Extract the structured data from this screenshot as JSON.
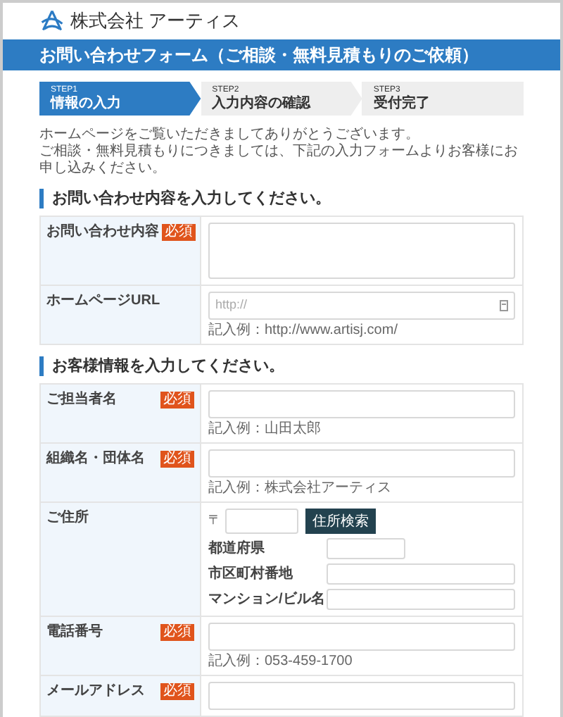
{
  "logo": {
    "company": "株式会社 アーティス"
  },
  "banner": {
    "title": "お問い合わせフォーム（ご相談・無料見積もりのご依頼）"
  },
  "steps": [
    {
      "step": "STEP1",
      "label": "情報の入力",
      "selected": true
    },
    {
      "step": "STEP2",
      "label": "入力内容の確認",
      "selected": false
    },
    {
      "step": "STEP3",
      "label": "受付完了",
      "selected": false
    }
  ],
  "intro": [
    "ホームページをご覧いただきましてありがとうございます。",
    "ご相談・無料見積もりにつきましては、下記の入力フォームよりお客様にお申し込みください。"
  ],
  "sections": [
    {
      "heading": "お問い合わせ内容を入力してください。",
      "rows": [
        {
          "kind": "textarea",
          "label": "お問い合わせ内容",
          "required": true,
          "badge": "必須"
        },
        {
          "kind": "input",
          "label": "ホームページURL",
          "required": false,
          "placeholder": "http://",
          "icon": true,
          "hint": "記入例：http://www.artisj.com/"
        }
      ]
    },
    {
      "heading": "お客様情報を入力してください。",
      "rows": [
        {
          "kind": "input",
          "label": "ご担当者名",
          "required": true,
          "badge": "必須",
          "hint": "記入例：山田太郎"
        },
        {
          "kind": "input",
          "label": "組織名・団体名",
          "required": true,
          "badge": "必須",
          "hint": "記入例：株式会社アーティス"
        },
        {
          "kind": "address",
          "label": "ご住所",
          "required": false,
          "postal_mark": "〒",
          "search_button": "住所検索",
          "fields": [
            {
              "label": "都道府県",
              "short": true
            },
            {
              "label": "市区町村番地",
              "short": false
            },
            {
              "label": "マンション/ビル名",
              "short": false
            }
          ]
        },
        {
          "kind": "input",
          "label": "電話番号",
          "required": true,
          "badge": "必須",
          "hint": "記入例：053-459-1700"
        },
        {
          "kind": "input",
          "label": "メールアドレス",
          "required": true,
          "badge": "必須"
        }
      ]
    }
  ]
}
